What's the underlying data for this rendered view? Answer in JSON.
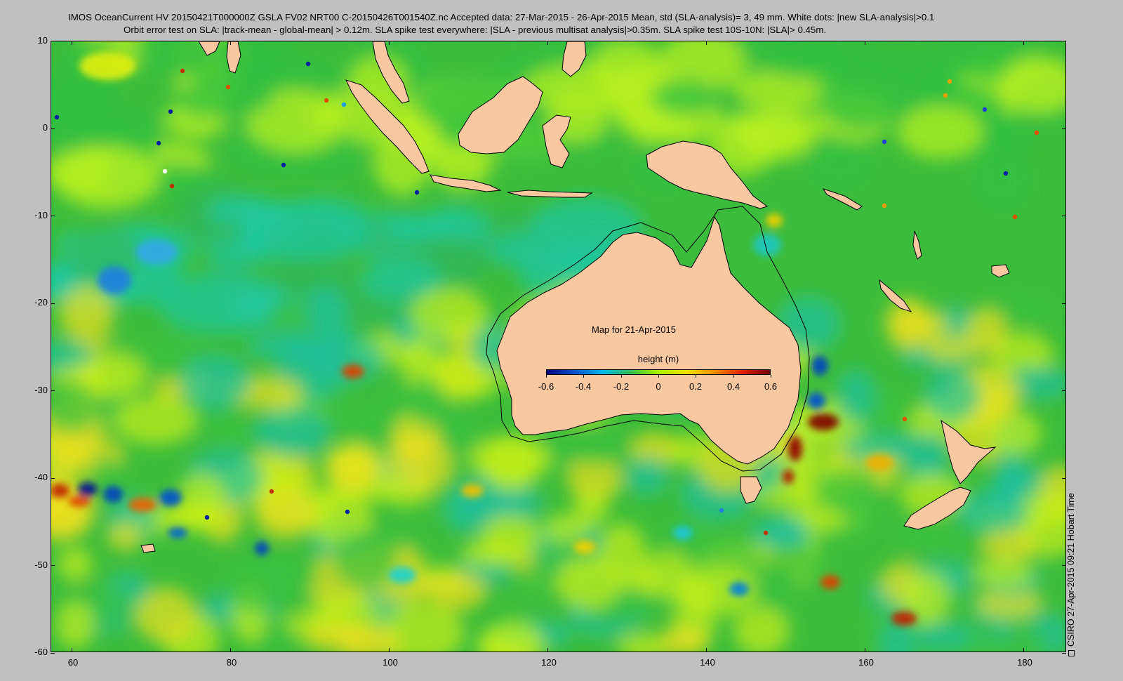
{
  "header": {
    "line1": "IMOS OceanCurrent HV 20150421T000000Z GSLA FV02 NRT00 C-20150426T001540Z.nc  Accepted data: 27-Mar-2015 - 26-Apr-2015 Mean, std (SLA-analysis)= 3, 49 mm. White dots: |new SLA-analysis|>0.1",
    "line2": "Orbit error test on SLA: |track-mean  - global-mean| > 0.12m.  SLA spike test everywhere: |SLA - previous multisat analysis|>0.35m. SLA spike test 10S-10N: |SLA|> 0.45m."
  },
  "map": {
    "lon_range": [
      57,
      185
    ],
    "lat_range": [
      -60,
      10
    ],
    "x_ticks": [
      "60",
      "80",
      "100",
      "120",
      "140",
      "160",
      "180"
    ],
    "y_ticks": [
      "10",
      "0",
      "-10",
      "-20",
      "-30",
      "-40",
      "-50",
      "-60"
    ],
    "map_date_label": "Map for 21-Apr-2015",
    "land_color": "#f9c8a0",
    "ocean_base_color": "#44c43c"
  },
  "colorbar": {
    "title": "height (m)",
    "labels": [
      "-0.6",
      "-0.4",
      "-0.2",
      "0",
      "0.2",
      "0.4",
      "0.6"
    ],
    "range": [
      -0.6,
      0.6
    ],
    "colors": [
      "#000080",
      "#0050d0",
      "#00b8f0",
      "#30c050",
      "#a8f000",
      "#f0e000",
      "#f09000",
      "#e02000",
      "#700000"
    ]
  },
  "credit": "CSIRO 27-Apr-2015 09:21 Hobart Time"
}
